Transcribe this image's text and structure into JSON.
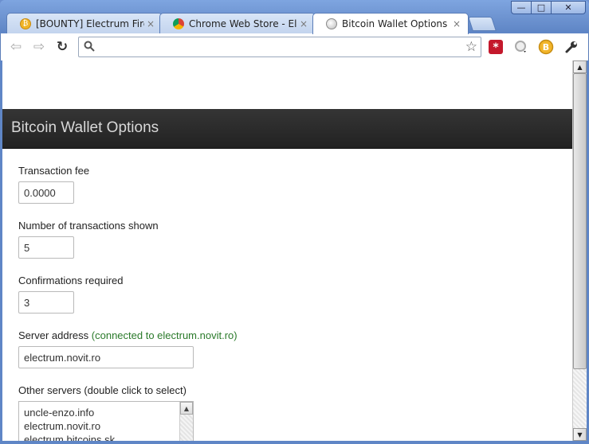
{
  "window": {
    "minimize_glyph": "—",
    "maximize_glyph": "□",
    "close_glyph": "✕"
  },
  "tabs": [
    {
      "title": "[BOUNTY] Electrum Firefox Ex",
      "favicon": "bitcoin-icon",
      "close": "×",
      "active": false
    },
    {
      "title": "Chrome Web Store - Electrum",
      "favicon": "chrome-web-store-icon",
      "close": "×",
      "active": false
    },
    {
      "title": "Bitcoin Wallet Options",
      "favicon": "globe-icon",
      "close": "×",
      "active": true
    }
  ],
  "toolbar": {
    "back_glyph": "⇦",
    "forward_glyph": "⇨",
    "reload_glyph": "↻",
    "address_value": "",
    "star_glyph": "☆",
    "wrench_glyph": "🔧"
  },
  "page": {
    "title": "Bitcoin Wallet Options",
    "fields": {
      "fee": {
        "label": "Transaction fee",
        "value": "0.0000"
      },
      "num_tx": {
        "label": "Number of transactions shown",
        "value": "5"
      },
      "confirmations": {
        "label": "Confirmations required",
        "value": "3"
      },
      "server": {
        "label": "Server address",
        "status": "(connected to electrum.novit.ro)",
        "value": "electrum.novit.ro"
      },
      "other_servers": {
        "label": "Other servers (double click to select)",
        "items": [
          "uncle-enzo.info",
          "electrum.novit.ro",
          "electrum.bitcoins.sk"
        ]
      }
    }
  },
  "colors": {
    "header_bg": "#2b2b2b",
    "header_text": "#d8d8d8",
    "status_green": "#2a7a2a",
    "window_frame": "#6f95d2"
  }
}
